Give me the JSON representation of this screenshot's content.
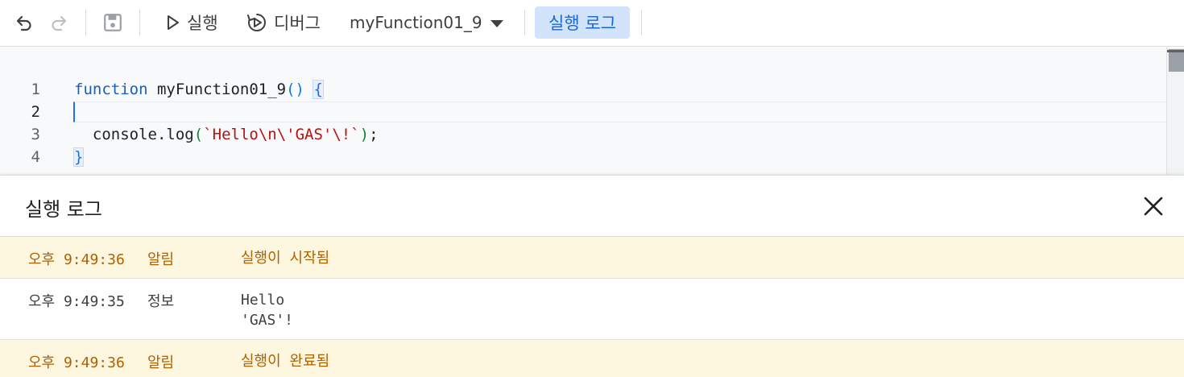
{
  "toolbar": {
    "undo_icon": "undo-icon",
    "redo_icon": "redo-icon",
    "save_icon": "save-icon",
    "run_label": "실행",
    "debug_label": "디버그",
    "function_selected": "myFunction01_9",
    "log_toggle_label": "실행 로그"
  },
  "editor": {
    "line_numbers": [
      "1",
      "2",
      "3",
      "4"
    ],
    "line1": {
      "kw": "function",
      "name": " myFunction01_9",
      "parens": "()",
      "sp": " ",
      "brace": "{"
    },
    "line3": {
      "indent": "  ",
      "call": "console.log",
      "open": "(",
      "str": "`Hello\\n\\'GAS'\\!`",
      "close": ")",
      "semi": ";"
    },
    "line4": {
      "brace": "}"
    }
  },
  "log_panel": {
    "title": "실행 로그",
    "rows": [
      {
        "time": "오후 9:49:36",
        "level": "알림",
        "message": "실행이 시작됨",
        "type": "warning"
      },
      {
        "time": "오후 9:49:35",
        "level": "정보",
        "message_line1": "Hello",
        "message_line2": "'GAS'!",
        "type": "info"
      },
      {
        "time": "오후 9:49:36",
        "level": "알림",
        "message": "실행이 완료됨",
        "type": "warning"
      }
    ]
  },
  "colors": {
    "accent": "#1a73e8",
    "toggle_bg": "#d2e3fc",
    "warning_bg": "#fef7e0",
    "warning_text": "#b06000"
  }
}
